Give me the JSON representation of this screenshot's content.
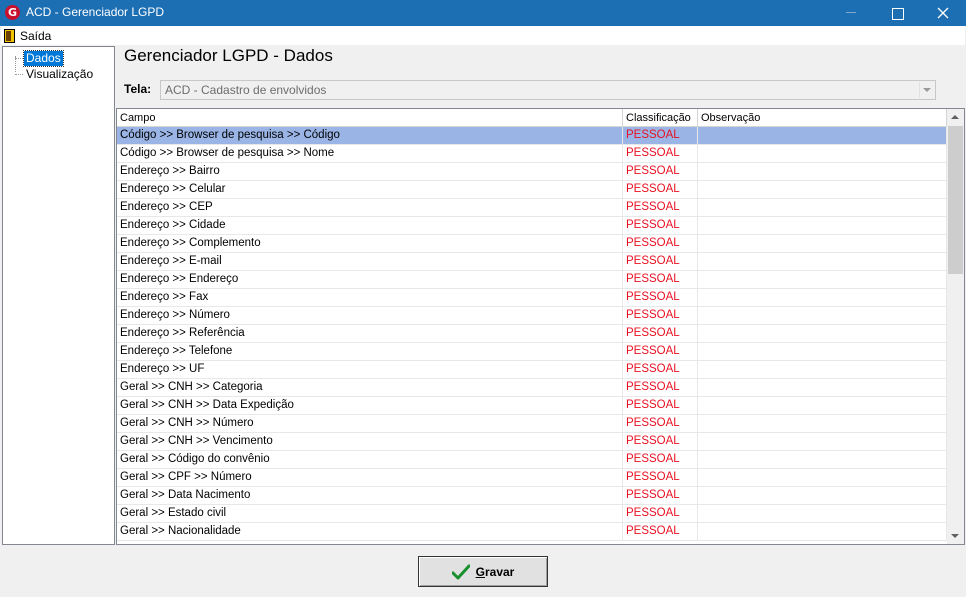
{
  "window": {
    "title": "ACD - Gerenciador LGPD",
    "icon_letter": "G"
  },
  "menu": {
    "exit_label": "Saída"
  },
  "tree": {
    "items": [
      {
        "label": "Dados",
        "selected": true
      },
      {
        "label": "Visualização",
        "selected": false
      }
    ]
  },
  "header": {
    "title": "Gerenciador LGPD - Dados"
  },
  "screen": {
    "label": "Tela:",
    "value": "ACD - Cadastro de envolvidos"
  },
  "grid": {
    "columns": [
      "Campo",
      "Classificação",
      "Observação"
    ],
    "rows": [
      {
        "campo": "Código >> Browser de pesquisa >> Código",
        "classificacao": "PESSOAL",
        "observacao": ""
      },
      {
        "campo": "Código >> Browser de pesquisa >> Nome",
        "classificacao": "PESSOAL",
        "observacao": ""
      },
      {
        "campo": "Endereço >> Bairro",
        "classificacao": "PESSOAL",
        "observacao": ""
      },
      {
        "campo": "Endereço >> Celular",
        "classificacao": "PESSOAL",
        "observacao": ""
      },
      {
        "campo": "Endereço >> CEP",
        "classificacao": "PESSOAL",
        "observacao": ""
      },
      {
        "campo": "Endereço >> Cidade",
        "classificacao": "PESSOAL",
        "observacao": ""
      },
      {
        "campo": "Endereço >> Complemento",
        "classificacao": "PESSOAL",
        "observacao": ""
      },
      {
        "campo": "Endereço >> E-mail",
        "classificacao": "PESSOAL",
        "observacao": ""
      },
      {
        "campo": "Endereço >> Endereço",
        "classificacao": "PESSOAL",
        "observacao": ""
      },
      {
        "campo": "Endereço >> Fax",
        "classificacao": "PESSOAL",
        "observacao": ""
      },
      {
        "campo": "Endereço >> Número",
        "classificacao": "PESSOAL",
        "observacao": ""
      },
      {
        "campo": "Endereço >> Referência",
        "classificacao": "PESSOAL",
        "observacao": ""
      },
      {
        "campo": "Endereço >> Telefone",
        "classificacao": "PESSOAL",
        "observacao": ""
      },
      {
        "campo": "Endereço >> UF",
        "classificacao": "PESSOAL",
        "observacao": ""
      },
      {
        "campo": "Geral >> CNH >> Categoria",
        "classificacao": "PESSOAL",
        "observacao": ""
      },
      {
        "campo": "Geral >> CNH >> Data Expedição",
        "classificacao": "PESSOAL",
        "observacao": ""
      },
      {
        "campo": "Geral >> CNH >> Número",
        "classificacao": "PESSOAL",
        "observacao": ""
      },
      {
        "campo": "Geral >> CNH >> Vencimento",
        "classificacao": "PESSOAL",
        "observacao": ""
      },
      {
        "campo": "Geral >> Código do convênio",
        "classificacao": "PESSOAL",
        "observacao": ""
      },
      {
        "campo": "Geral >> CPF >> Número",
        "classificacao": "PESSOAL",
        "observacao": ""
      },
      {
        "campo": "Geral >> Data Nacimento",
        "classificacao": "PESSOAL",
        "observacao": ""
      },
      {
        "campo": "Geral >> Estado civil",
        "classificacao": "PESSOAL",
        "observacao": ""
      },
      {
        "campo": "Geral >> Nacionalidade",
        "classificacao": "PESSOAL",
        "observacao": ""
      }
    ],
    "selected_row": 0
  },
  "footer": {
    "save_label": "Gravar"
  },
  "colors": {
    "titlebar": "#1d6fb4",
    "selection": "#99b4e5",
    "classification_text": "#e81123",
    "check_icon": "#1a8f2e"
  }
}
